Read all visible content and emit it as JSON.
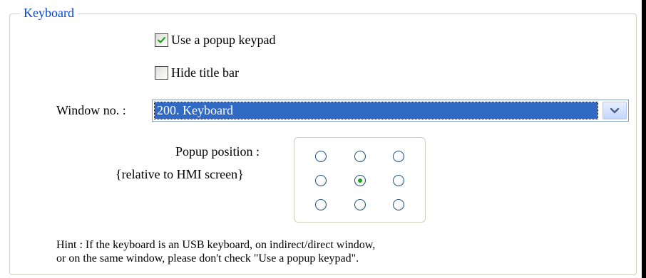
{
  "keyboard_group": {
    "legend": "Keyboard",
    "use_popup_keypad": {
      "label": "Use a popup keypad",
      "checked": true
    },
    "hide_title_bar": {
      "label": "Hide title bar",
      "checked": false
    },
    "window_no": {
      "label": "Window no. :",
      "value": "200. Keyboard"
    },
    "popup_position": {
      "label": "Popup position :",
      "sublabel": "{relative to HMI screen}",
      "selected": "middle-center"
    },
    "hint": {
      "line1": "Hint : If the keyboard is an USB keyboard, on indirect/direct window,",
      "line2": "or on the same window, please don't check \"Use a popup keypad\"."
    }
  },
  "colors": {
    "legend_text": "#0046d5",
    "selection_bg": "#316ac5",
    "check_mark": "#21a121",
    "group_border": "#d0d0bf"
  }
}
